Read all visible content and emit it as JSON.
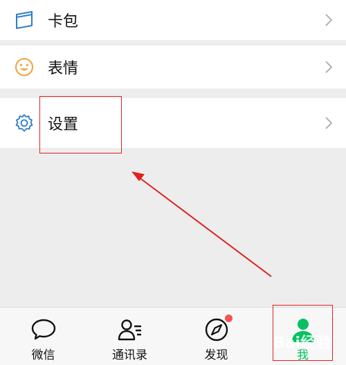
{
  "menu": {
    "card_package": {
      "label": "卡包",
      "icon": "card-icon"
    },
    "stickers": {
      "label": "表情",
      "icon": "smiley-icon"
    },
    "settings": {
      "label": "设置",
      "icon": "gear-icon"
    }
  },
  "tabs": [
    {
      "label": "微信",
      "icon": "chat-bubble-icon"
    },
    {
      "label": "通讯录",
      "icon": "contacts-icon"
    },
    {
      "label": "发现",
      "icon": "compass-icon",
      "badge": true
    },
    {
      "label": "我",
      "icon": "person-icon",
      "active": true
    }
  ],
  "watermark": "Bai经验",
  "colors": {
    "active_green": "#07c160",
    "badge_red": "#fa5151",
    "annotation_red": "#e02020",
    "icon_blue": "#2c7dc7",
    "icon_orange": "#f0a23a"
  }
}
